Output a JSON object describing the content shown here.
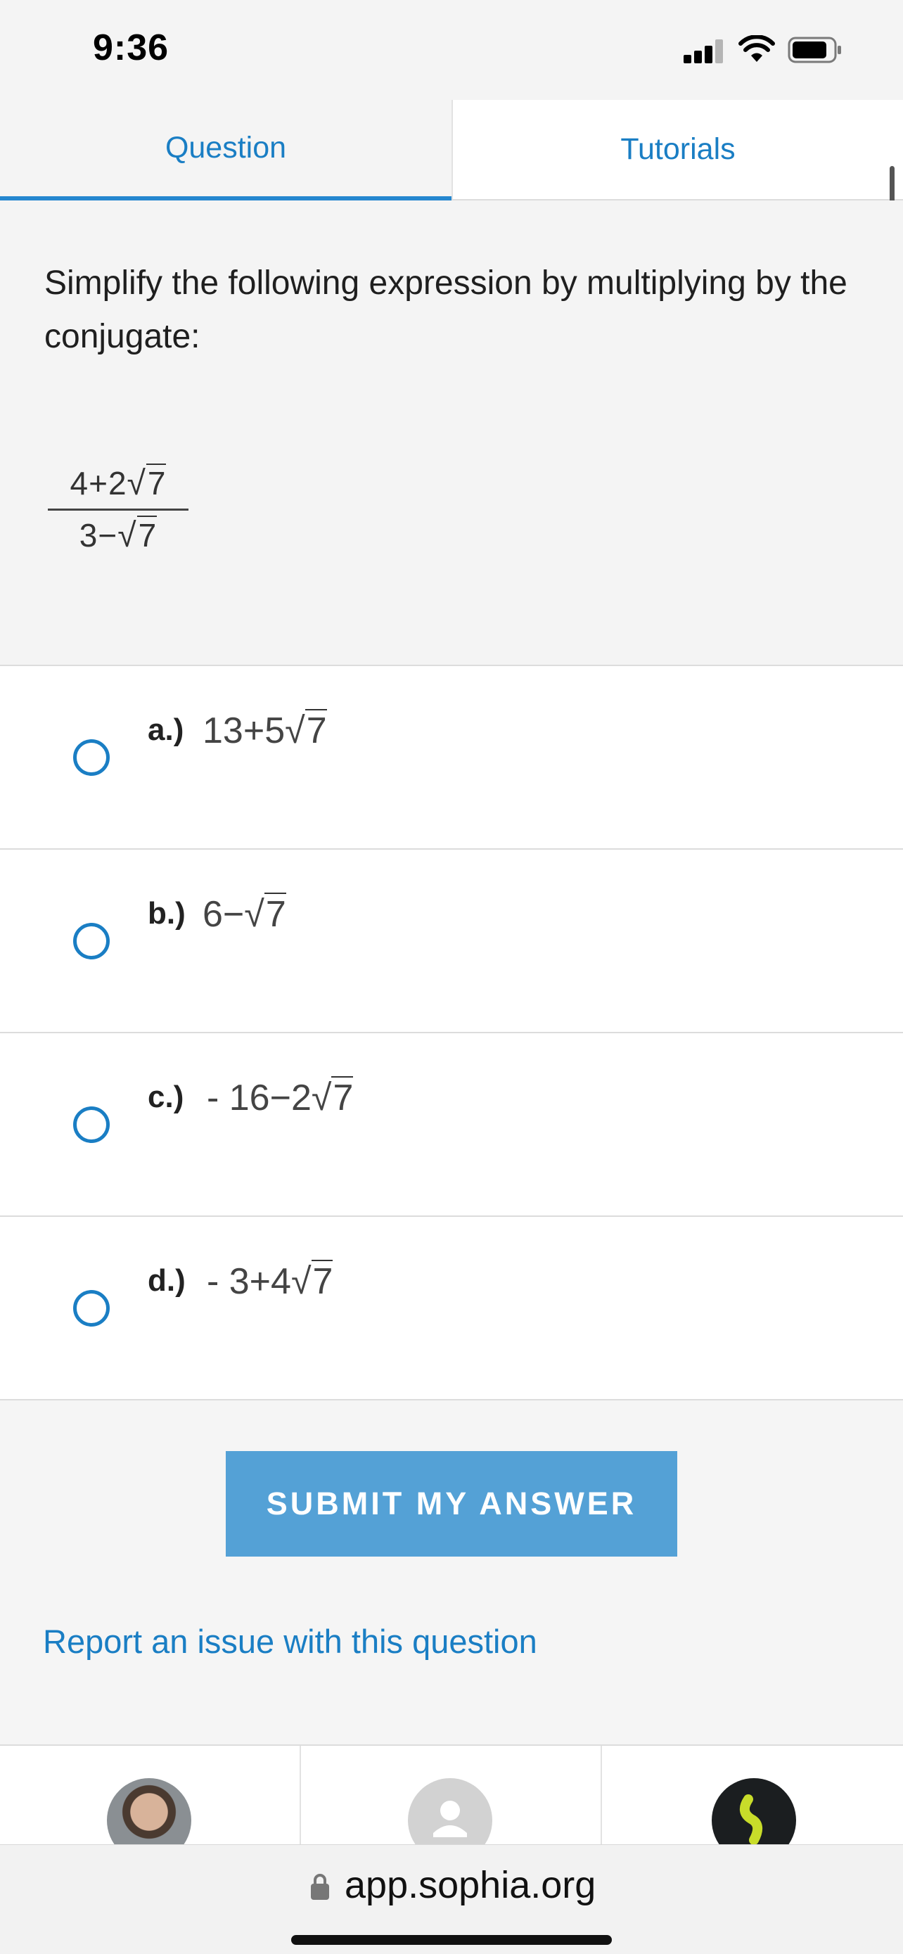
{
  "status_bar": {
    "time": "9:36"
  },
  "tabs": [
    {
      "label": "Question",
      "active": true
    },
    {
      "label": "Tutorials",
      "active": false
    }
  ],
  "question": {
    "prompt": "Simplify the following expression by multiplying by the conjugate:",
    "expression": {
      "numerator": {
        "a": "4+2",
        "radicand": "7"
      },
      "denominator": {
        "a": "3−",
        "radicand": "7"
      }
    }
  },
  "options": [
    {
      "label": "a.)",
      "pre": "13+5",
      "radicand": "7"
    },
    {
      "label": "b.)",
      "pre": "6−",
      "radicand": "7"
    },
    {
      "label": "c.)",
      "pre": "- 16−2",
      "radicand": "7"
    },
    {
      "label": "d.)",
      "pre": "- 3+4",
      "radicand": "7"
    }
  ],
  "submit_label": "SUBMIT MY ANSWER",
  "report_link": "Report an issue with this question",
  "browser": {
    "url": "app.sophia.org"
  },
  "colors": {
    "accent": "#1a7ec4",
    "submit_bg": "#54a1d6",
    "tab_underline": "#2587cf"
  },
  "icons": {
    "signal": "cellular-signal-icon",
    "wifi": "wifi-icon",
    "battery": "battery-icon",
    "lock": "lock-icon",
    "profile": "person-icon",
    "logo": "sophia-logo-icon"
  }
}
